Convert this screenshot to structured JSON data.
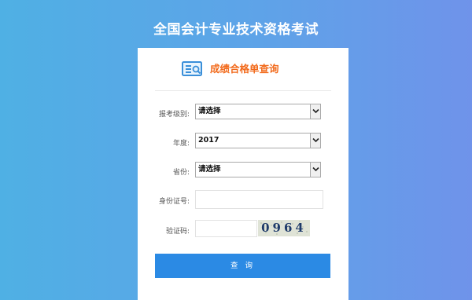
{
  "page": {
    "title": "全国会计专业技术资格考试"
  },
  "card": {
    "header_icon": "score-query-icon",
    "header_title": "成绩合格单查询"
  },
  "form": {
    "exam_level": {
      "label": "报考级别:",
      "value": "请选择"
    },
    "year": {
      "label": "年度:",
      "value": "2017"
    },
    "province": {
      "label": "省份:",
      "value": "请选择"
    },
    "id_number": {
      "label": "身份证号:",
      "value": ""
    },
    "captcha": {
      "label": "验证码:",
      "value": "",
      "image_text": "0964"
    },
    "submit_label": "查 询"
  },
  "colors": {
    "background_start": "#4fb0e4",
    "background_end": "#6f93ea",
    "header_title": "#f26a1b",
    "button": "#2b8ae4",
    "icon": "#3a8fd9"
  }
}
